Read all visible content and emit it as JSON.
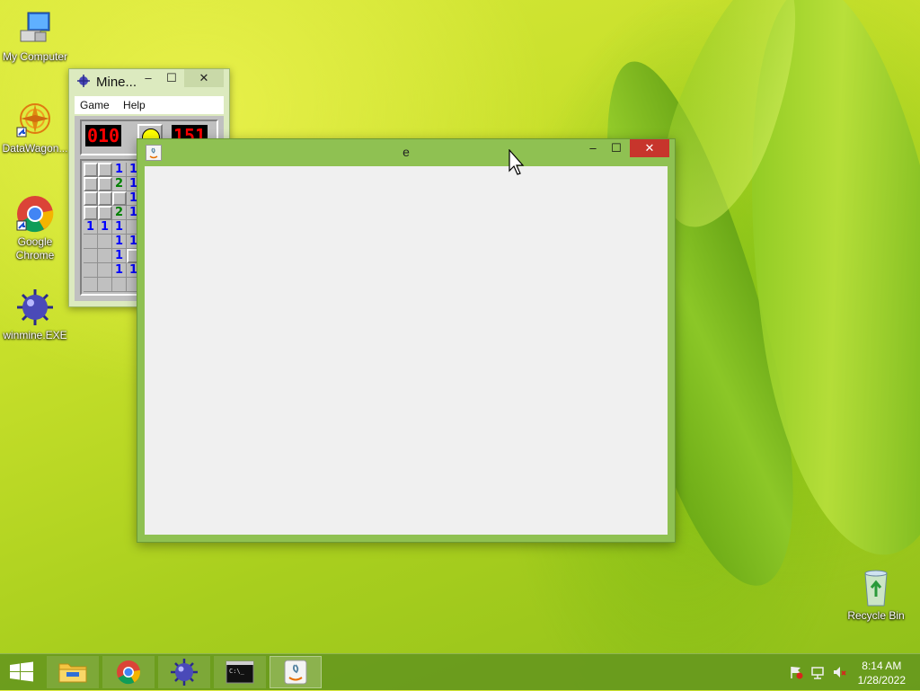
{
  "desktop": {
    "icons": [
      {
        "label": "My Computer",
        "icon": "computer-icon"
      },
      {
        "label": "DataWagon...",
        "icon": "datawagon-icon"
      },
      {
        "label": "Google\nChrome",
        "icon": "chrome-icon"
      },
      {
        "label": "winmine.EXE",
        "icon": "minesweeper-icon"
      },
      {
        "label": "Recycle Bin",
        "icon": "recycle-bin-icon"
      }
    ]
  },
  "minesweeper": {
    "title": "Mine...",
    "title_buttons": {
      "minimize": "–",
      "maximize": "☐",
      "close": "✕"
    },
    "menu": [
      "Game",
      "Help"
    ],
    "mine_counter": "010",
    "timer": "151",
    "grid_rows": [
      [
        "H",
        "H",
        "1",
        "1"
      ],
      [
        "H",
        "H",
        "2",
        "1"
      ],
      [
        "H",
        "H",
        "H",
        "1"
      ],
      [
        "H",
        "H",
        "2",
        "1"
      ],
      [
        "1",
        "1",
        "1",
        "O"
      ],
      [
        "O",
        "O",
        "1",
        "1"
      ],
      [
        "O",
        "O",
        "1",
        "H"
      ],
      [
        "O",
        "O",
        "1",
        "1"
      ],
      [
        "O",
        "O",
        "O",
        "O"
      ]
    ],
    "colors": {
      "1": "#0000ff",
      "2": "#008000"
    }
  },
  "java_window": {
    "title": "e",
    "title_buttons": {
      "minimize": "–",
      "maximize": "☐",
      "close": "✕"
    }
  },
  "taskbar": {
    "buttons": [
      "start-button",
      "file-explorer",
      "chrome",
      "minesweeper",
      "command-prompt",
      "java"
    ],
    "clock_time": "8:14 AM",
    "clock_date": "1/28/2022",
    "tray_icons": [
      "action-center-flag-icon",
      "network-icon",
      "volume-muted-icon"
    ]
  },
  "colors": {
    "java_frame": "#8fc152",
    "java_close": "#c7352c",
    "taskbar": "#64961e"
  }
}
